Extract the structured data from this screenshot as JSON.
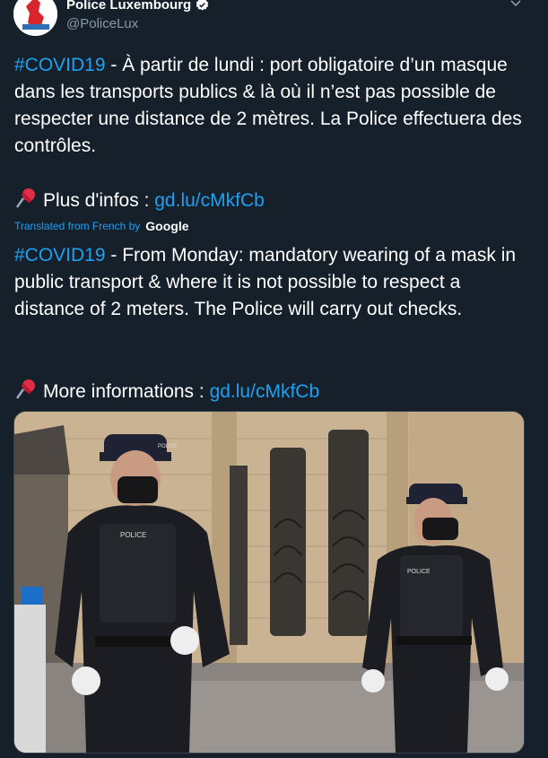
{
  "header": {
    "display_name": "Police Luxembourg",
    "handle": "@PoliceLux",
    "verified_icon": "verified-badge-icon",
    "menu_icon": "chevron-down-icon"
  },
  "tweet": {
    "fr": {
      "hashtag": "#COVID19",
      "text": " - À partir de lundi : port obligatoire d’un masque dans les transports publics & là où il n’est pas possible de respecter une distance de 2 mètres. La Police effectuera des contrôles.",
      "infos_label": "Plus d'infos : ",
      "infos_link": "gd.lu/cMkfCb"
    },
    "translation": {
      "label": "Translated from French by",
      "provider": "Google"
    },
    "en": {
      "hashtag": "#COVID19",
      "text": " - From Monday: mandatory wearing of a mask in public transport & where it is not possible to respect a distance of 2 meters. The Police will carry out checks.",
      "infos_label": "More informations : ",
      "infos_link": "gd.lu/cMkfCb"
    },
    "pin_icon": "pushpin-icon"
  },
  "media": {
    "vest_label_left": "POLICE",
    "vest_label_right": "POLICE",
    "cap_label": "POLICE",
    "description_icon": "photo-police-officers"
  },
  "colors": {
    "background": "#15202b",
    "link": "#1da1f2",
    "secondary_text": "#8899a6"
  }
}
